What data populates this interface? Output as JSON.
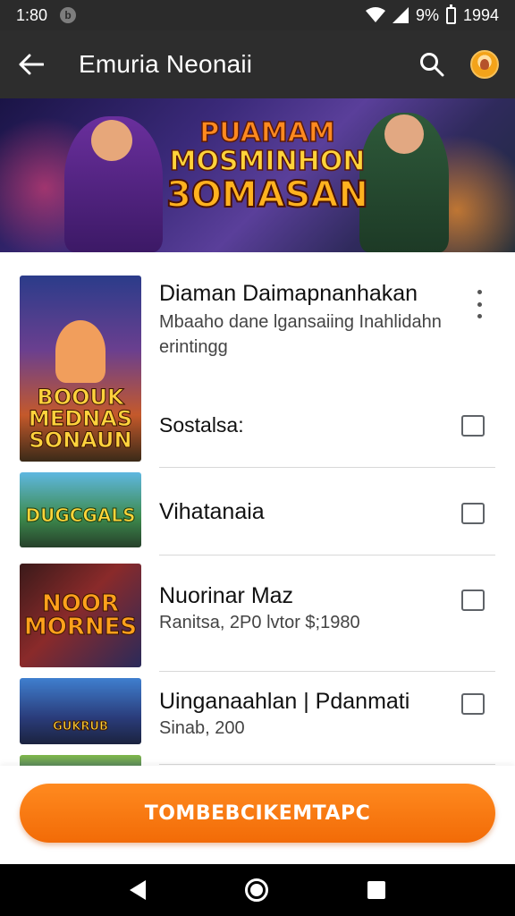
{
  "status_bar": {
    "time": "1:80",
    "battery_text": "9%",
    "right_time": "1994"
  },
  "app_bar": {
    "title": "Emuria Neonaii"
  },
  "banner": {
    "title_line1": "PUAMAM",
    "title_line2": "MOSMINHON",
    "title_line3": "3OMASAN"
  },
  "items": [
    {
      "title": "Diaman Daimapnanhakan",
      "subtitle": "Mbaaho dane lgansaiing Inahlidahn erintingg",
      "sub_label": "Sostalsa:",
      "thumb_caption": "BOOUK MEDNAS SONAUN",
      "checked": false
    },
    {
      "title": "Vihatanaia",
      "thumb_caption": "DUGCGALS",
      "checked": false
    },
    {
      "title": "Nuorinar Maz",
      "subtitle": "Ranitsa, 2P0 lvtor $;1980",
      "thumb_caption": "NOOR MORNES",
      "checked": false
    },
    {
      "title": "Uinganaahlan | Pdanmati",
      "subtitle": "Sinab, 200",
      "thumb_caption": "GUKRUB",
      "checked": false
    }
  ],
  "cta": {
    "label": "TOMBEBCIKEMTAPC"
  },
  "colors": {
    "accent": "#f47a10",
    "app_bar": "#2d2d2d",
    "status_bar": "#2b2b2b"
  },
  "icons": {
    "back": "arrow-left",
    "search": "magnifier",
    "more": "vertical-dots",
    "nav_back": "triangle-left",
    "nav_home": "circle",
    "nav_recents": "square"
  }
}
